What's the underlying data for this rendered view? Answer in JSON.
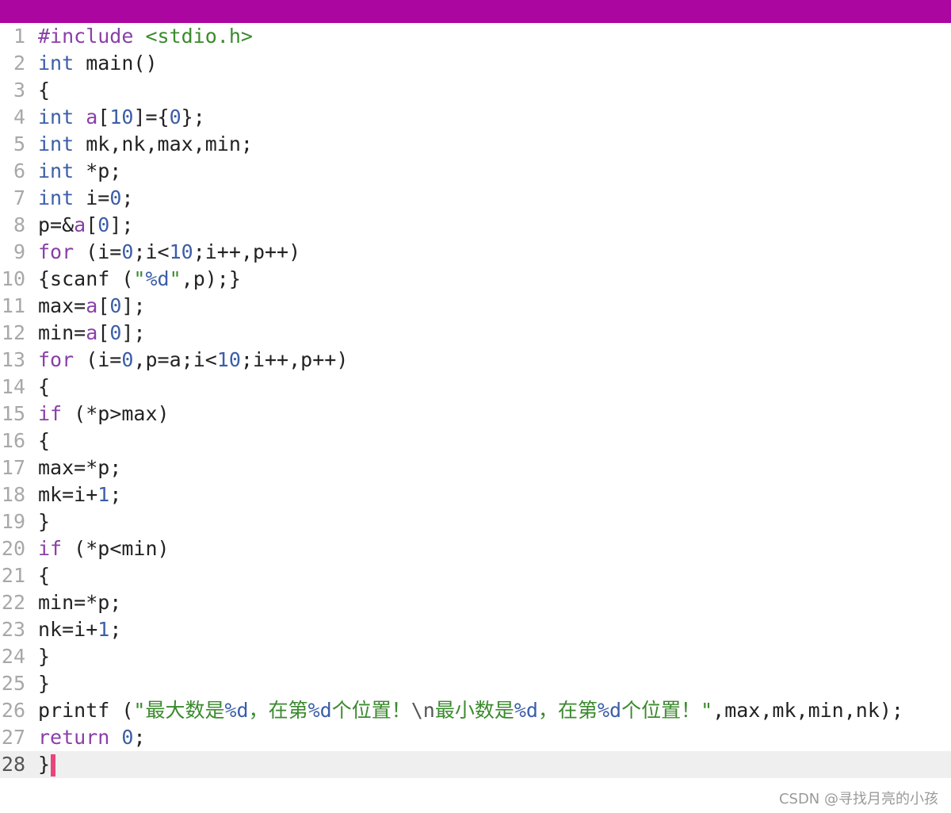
{
  "editor": {
    "lines": [
      {
        "n": "1",
        "tokens": [
          {
            "t": "#include ",
            "c": "pre"
          },
          {
            "t": "<stdio.h>",
            "c": "inc"
          }
        ]
      },
      {
        "n": "2",
        "tokens": [
          {
            "t": "int",
            "c": "kw"
          },
          {
            "t": " main()",
            "c": "plain"
          }
        ]
      },
      {
        "n": "3",
        "tokens": [
          {
            "t": "{",
            "c": "plain"
          }
        ]
      },
      {
        "n": "4",
        "tokens": [
          {
            "t": "int",
            "c": "kw"
          },
          {
            "t": " ",
            "c": "plain"
          },
          {
            "t": "a",
            "c": "var"
          },
          {
            "t": "[",
            "c": "plain"
          },
          {
            "t": "10",
            "c": "num"
          },
          {
            "t": "]={",
            "c": "plain"
          },
          {
            "t": "0",
            "c": "num"
          },
          {
            "t": "};",
            "c": "plain"
          }
        ]
      },
      {
        "n": "5",
        "tokens": [
          {
            "t": "int",
            "c": "kw"
          },
          {
            "t": " mk,nk,max,min;",
            "c": "plain"
          }
        ]
      },
      {
        "n": "6",
        "tokens": [
          {
            "t": "int",
            "c": "kw"
          },
          {
            "t": " *p;",
            "c": "plain"
          }
        ]
      },
      {
        "n": "7",
        "tokens": [
          {
            "t": "int",
            "c": "kw"
          },
          {
            "t": " i=",
            "c": "plain"
          },
          {
            "t": "0",
            "c": "num"
          },
          {
            "t": ";",
            "c": "plain"
          }
        ]
      },
      {
        "n": "8",
        "tokens": [
          {
            "t": "p=&",
            "c": "plain"
          },
          {
            "t": "a",
            "c": "var"
          },
          {
            "t": "[",
            "c": "plain"
          },
          {
            "t": "0",
            "c": "num"
          },
          {
            "t": "];",
            "c": "plain"
          }
        ]
      },
      {
        "n": "9",
        "tokens": [
          {
            "t": "for",
            "c": "kw2"
          },
          {
            "t": " (i=",
            "c": "plain"
          },
          {
            "t": "0",
            "c": "num"
          },
          {
            "t": ";i<",
            "c": "plain"
          },
          {
            "t": "10",
            "c": "num"
          },
          {
            "t": ";i++,p++)",
            "c": "plain"
          }
        ]
      },
      {
        "n": "10",
        "tokens": [
          {
            "t": "{scanf (",
            "c": "plain"
          },
          {
            "t": "\"",
            "c": "str"
          },
          {
            "t": "%d",
            "c": "fmt"
          },
          {
            "t": "\"",
            "c": "str"
          },
          {
            "t": ",p);}",
            "c": "plain"
          }
        ]
      },
      {
        "n": "11",
        "tokens": [
          {
            "t": "max=",
            "c": "plain"
          },
          {
            "t": "a",
            "c": "var"
          },
          {
            "t": "[",
            "c": "plain"
          },
          {
            "t": "0",
            "c": "num"
          },
          {
            "t": "];",
            "c": "plain"
          }
        ]
      },
      {
        "n": "12",
        "tokens": [
          {
            "t": "min=",
            "c": "plain"
          },
          {
            "t": "a",
            "c": "var"
          },
          {
            "t": "[",
            "c": "plain"
          },
          {
            "t": "0",
            "c": "num"
          },
          {
            "t": "];",
            "c": "plain"
          }
        ]
      },
      {
        "n": "13",
        "tokens": [
          {
            "t": "for",
            "c": "kw2"
          },
          {
            "t": " (i=",
            "c": "plain"
          },
          {
            "t": "0",
            "c": "num"
          },
          {
            "t": ",p=a;i<",
            "c": "plain"
          },
          {
            "t": "10",
            "c": "num"
          },
          {
            "t": ";i++,p++)",
            "c": "plain"
          }
        ]
      },
      {
        "n": "14",
        "tokens": [
          {
            "t": "{",
            "c": "plain"
          }
        ]
      },
      {
        "n": "15",
        "tokens": [
          {
            "t": "if",
            "c": "kw2"
          },
          {
            "t": " (*p>max)",
            "c": "plain"
          }
        ]
      },
      {
        "n": "16",
        "tokens": [
          {
            "t": "{",
            "c": "plain"
          }
        ]
      },
      {
        "n": "17",
        "tokens": [
          {
            "t": "max=*p;",
            "c": "plain"
          }
        ]
      },
      {
        "n": "18",
        "tokens": [
          {
            "t": "mk=i+",
            "c": "plain"
          },
          {
            "t": "1",
            "c": "num"
          },
          {
            "t": ";",
            "c": "plain"
          }
        ]
      },
      {
        "n": "19",
        "tokens": [
          {
            "t": "}",
            "c": "plain"
          }
        ]
      },
      {
        "n": "20",
        "tokens": [
          {
            "t": "if",
            "c": "kw2"
          },
          {
            "t": " (*p<min)",
            "c": "plain"
          }
        ]
      },
      {
        "n": "21",
        "tokens": [
          {
            "t": "{",
            "c": "plain"
          }
        ]
      },
      {
        "n": "22",
        "tokens": [
          {
            "t": "min=*p;",
            "c": "plain"
          }
        ]
      },
      {
        "n": "23",
        "tokens": [
          {
            "t": "nk=i+",
            "c": "plain"
          },
          {
            "t": "1",
            "c": "num"
          },
          {
            "t": ";",
            "c": "plain"
          }
        ]
      },
      {
        "n": "24",
        "tokens": [
          {
            "t": "}",
            "c": "plain"
          }
        ]
      },
      {
        "n": "25",
        "tokens": [
          {
            "t": "}",
            "c": "plain"
          }
        ]
      },
      {
        "n": "26",
        "tokens": [
          {
            "t": "printf (",
            "c": "plain"
          },
          {
            "t": "\"最大数是",
            "c": "str"
          },
          {
            "t": "%d",
            "c": "fmt"
          },
          {
            "t": "，在第",
            "c": "str"
          },
          {
            "t": "%d",
            "c": "fmt"
          },
          {
            "t": "个位置！",
            "c": "str"
          },
          {
            "t": "\\n",
            "c": "op"
          },
          {
            "t": "最小数是",
            "c": "str"
          },
          {
            "t": "%d",
            "c": "fmt"
          },
          {
            "t": "，在第",
            "c": "str"
          },
          {
            "t": "%d",
            "c": "fmt"
          },
          {
            "t": "个位置！\"",
            "c": "str"
          },
          {
            "t": ",max,mk,min,nk);",
            "c": "plain"
          }
        ]
      },
      {
        "n": "27",
        "tokens": [
          {
            "t": "return",
            "c": "kw2"
          },
          {
            "t": " ",
            "c": "plain"
          },
          {
            "t": "0",
            "c": "num"
          },
          {
            "t": ";",
            "c": "plain"
          }
        ]
      },
      {
        "n": "28",
        "tokens": [
          {
            "t": "}",
            "c": "plain"
          }
        ],
        "current": true
      }
    ]
  },
  "watermark": "CSDN @寻找月亮的小孩",
  "colors": {
    "topbar": "#ab069f",
    "cursor": "#e8457a",
    "current_line": "#efefef"
  }
}
